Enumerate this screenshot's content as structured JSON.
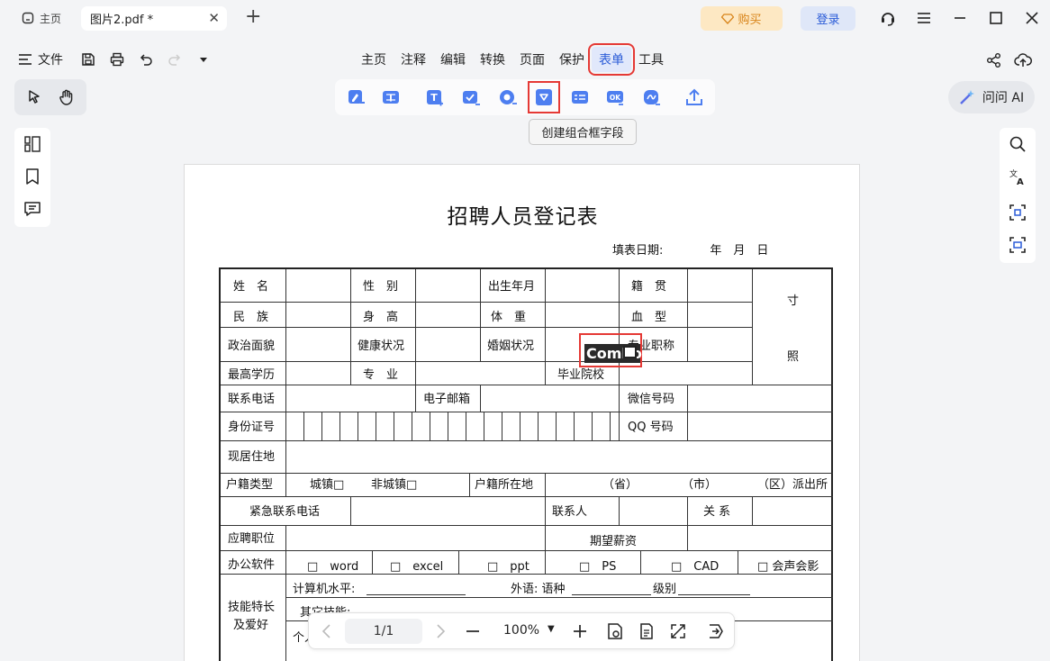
{
  "titlebar": {
    "home_tab": "主页",
    "doc_tab": "图片2.pdf *",
    "buy_label": "购买",
    "login_label": "登录"
  },
  "menubar": {
    "file_label": "文件",
    "tabs": [
      "主页",
      "注释",
      "编辑",
      "转换",
      "页面",
      "保护",
      "表单",
      "工具"
    ],
    "active_tab": "表单",
    "ask_ai": "问问 AI"
  },
  "ribbon": {
    "tools": [
      "text-field-icon",
      "text-box-icon",
      "text-label-icon",
      "checkbox-icon",
      "radio-button-icon",
      "combo-box-icon",
      "list-box-icon",
      "button-field-icon",
      "signature-field-icon",
      "export-data-icon"
    ],
    "selected_tool": "combo-box-icon",
    "tooltip": "创建组合框字段"
  },
  "document": {
    "title": "招聘人员登记表",
    "fill_date": "填表日期:　　　　年　月　日",
    "combo_label": "Combo",
    "labels": {
      "name": "姓　名",
      "gender": "性　别",
      "birth": "出生年月",
      "origin": "籍　贯",
      "photo_1": "寸",
      "photo_2": "照",
      "ethnicity": "民　族",
      "height": "身　高",
      "weight": "体　重",
      "blood": "血　型",
      "politics": "政治面貌",
      "health": "健康状况",
      "marital": "婚姻状况",
      "title": "专业职称",
      "education": "最高学历",
      "major": "专　业",
      "school": "毕业院校",
      "phone": "联系电话",
      "email": "电子邮箱",
      "wechat": "微信号码",
      "id_number": "身份证号",
      "qq": "QQ 号码",
      "address": "现居住地",
      "hukou_type": "户籍类型",
      "urban": "城镇□",
      "nonurban": "非城镇□",
      "hukou_loc": "户籍所在地",
      "province": "（省）",
      "city": "（市）",
      "district": "（区）派出所",
      "emergency": "紧急联系电话",
      "contact": "联系人",
      "relation": "关 系",
      "position": "应聘职位",
      "salary": "期望薪资",
      "software": "办公软件",
      "sw_word": "□　word",
      "sw_excel": "□　excel",
      "sw_ppt": "□　ppt",
      "sw_ps": "□　PS",
      "sw_cad": "□　CAD",
      "sw_audio": "□ 会声会影",
      "skills_1": "技能特长",
      "skills_2": "及爱好",
      "computer_level": "计算机水平:",
      "foreign_lang": "外语: 语种",
      "level": "级别",
      "other_skills": "其它技能:",
      "personal": "个人"
    }
  },
  "pager": {
    "page": "1/1",
    "zoom": "100%"
  }
}
